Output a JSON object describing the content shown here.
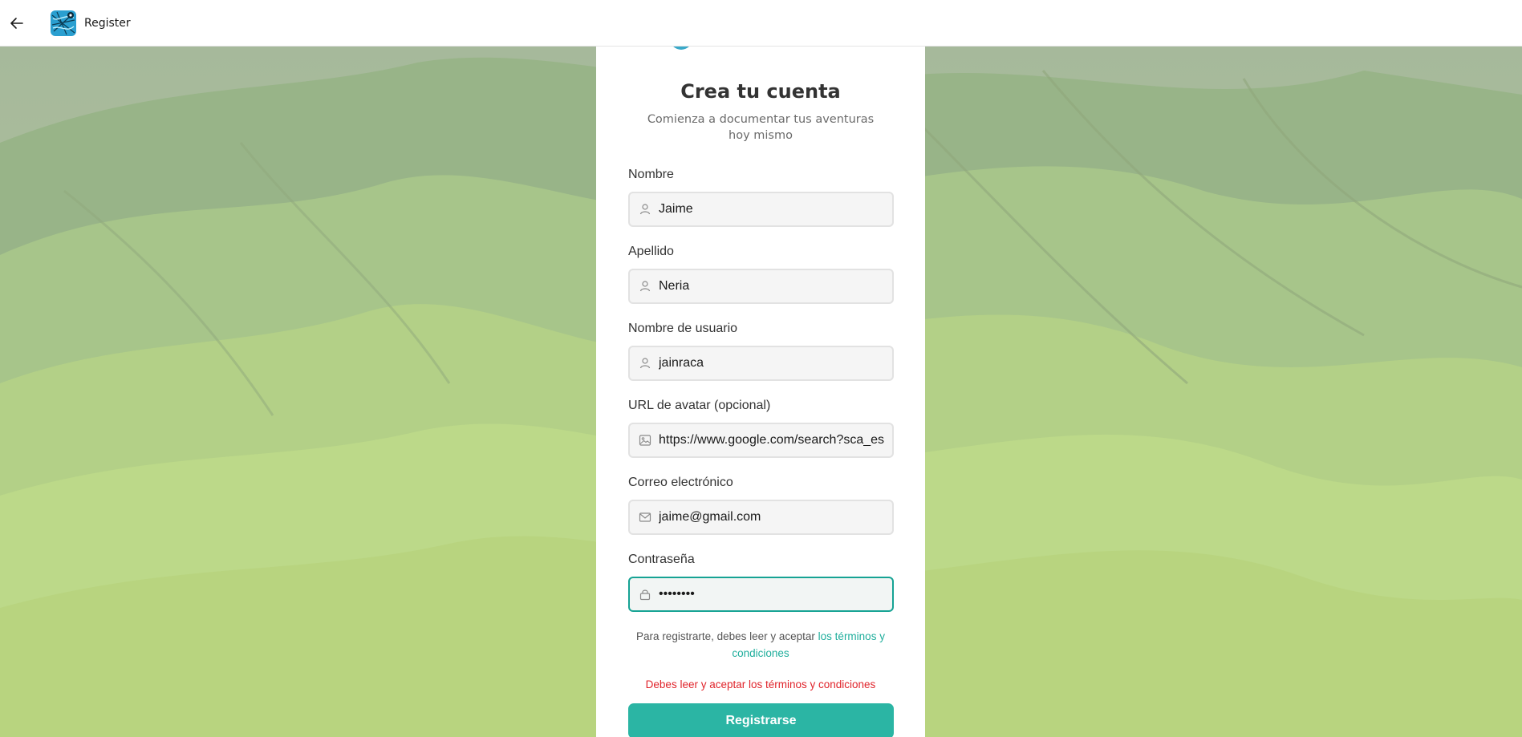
{
  "window": {
    "title": "Register"
  },
  "form": {
    "title": "Crea tu cuenta",
    "subtitle": "Comienza a documentar tus aventuras hoy mismo",
    "fields": [
      {
        "label": "Nombre",
        "value": "Jaime",
        "icon": "user-icon"
      },
      {
        "label": "Apellido",
        "value": "Neria",
        "icon": "user-icon"
      },
      {
        "label": "Nombre de usuario",
        "value": "jainraca",
        "icon": "user-icon"
      },
      {
        "label": "URL de avatar (opcional)",
        "value": "https://www.google.com/search?sca_es",
        "icon": "image-icon"
      },
      {
        "label": "Correo electrónico",
        "value": "jaime@gmail.com",
        "icon": "mail-icon"
      },
      {
        "label": "Contraseña",
        "value": "••••••••",
        "icon": "lock-icon"
      }
    ],
    "terms_prefix": "Para registrarte, debes leer y aceptar ",
    "terms_link": "los términos y condiciones",
    "error": "Debes leer y aceptar los términos y condiciones",
    "submit_label": "Registrarse"
  },
  "colors": {
    "accent": "#2bb5a4",
    "focus_border": "#16a394",
    "error": "#e0242b",
    "landscape": "#a9c583"
  }
}
